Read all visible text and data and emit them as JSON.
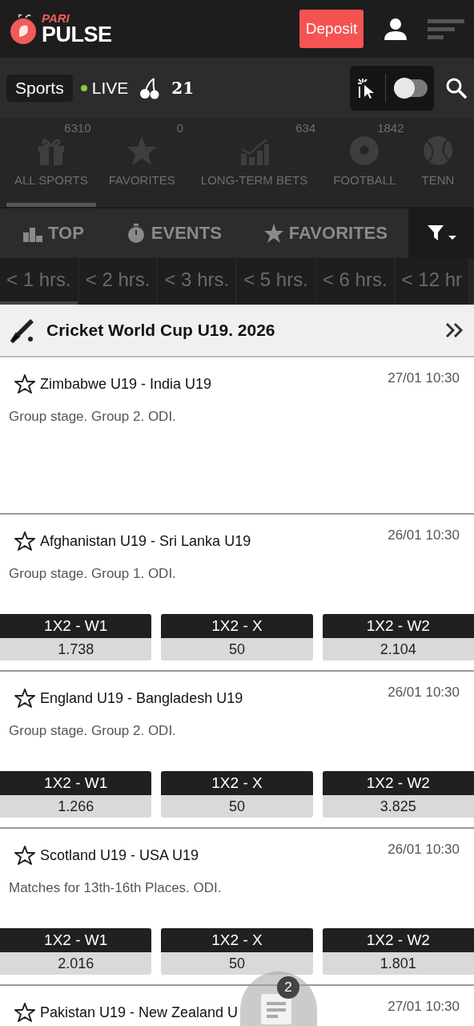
{
  "header": {
    "logo_top": "PARI",
    "logo_bottom": "PULSE",
    "deposit": "Deposit"
  },
  "nav": {
    "sports": "Sports",
    "live": "LIVE",
    "number_icon": "21",
    "toggle_on": false
  },
  "categories": [
    {
      "kind": "gift",
      "count": "6310",
      "label": "ALL SPORTS",
      "selected": true
    },
    {
      "kind": "star",
      "count": "0",
      "label": "FAVORITES",
      "selected": false
    },
    {
      "kind": "chart",
      "count": "634",
      "label": "LONG-TERM BETS",
      "selected": false
    },
    {
      "kind": "ball",
      "count": "1842",
      "label": "FOOTBALL",
      "selected": false
    },
    {
      "kind": "tennis",
      "label": "TENN",
      "selected": false
    }
  ],
  "tabs": [
    {
      "kind": "bars",
      "label": "TOP",
      "selected": false
    },
    {
      "kind": "timer",
      "label": "EVENTS",
      "selected": false
    },
    {
      "kind": "star",
      "label": "FAVORITES",
      "selected": false
    }
  ],
  "time_filters": [
    {
      "label": "< 1 hrs.",
      "selected": true
    },
    {
      "label": "< 2 hrs.",
      "selected": false
    },
    {
      "label": "< 3 hrs.",
      "selected": false
    },
    {
      "label": "< 5 hrs.",
      "selected": false
    },
    {
      "label": "< 6 hrs.",
      "selected": false
    },
    {
      "label": "< 12 hr",
      "selected": false
    }
  ],
  "league": {
    "title": "Cricket World Cup U19. 2026"
  },
  "matches": [
    {
      "teams": "Zimbabwe U19 - India U19",
      "time": "27/01 10:30",
      "info": "Group stage. Group 2. ODI.",
      "favorite": false
    },
    {
      "teams": "Afghanistan U19 - Sri Lanka U19",
      "time": "26/01 10:30",
      "info": "Group stage. Group 1. ODI.",
      "favorite": false,
      "odds": [
        {
          "label": "1X2 - W1",
          "value": "1.738"
        },
        {
          "label": "1X2 - X",
          "value": "50"
        },
        {
          "label": "1X2 - W2",
          "value": "2.104"
        }
      ]
    },
    {
      "teams": "England U19 - Bangladesh U19",
      "time": "26/01 10:30",
      "info": "Group stage. Group 2. ODI.",
      "favorite": false,
      "odds": [
        {
          "label": "1X2 - W1",
          "value": "1.266"
        },
        {
          "label": "1X2 - X",
          "value": "50"
        },
        {
          "label": "1X2 - W2",
          "value": "3.825"
        }
      ]
    },
    {
      "teams": "Scotland U19 - USA U19",
      "time": "26/01 10:30",
      "info": "Matches for 13th-16th Places. ODI.",
      "favorite": false,
      "odds": [
        {
          "label": "1X2 - W1",
          "value": "2.016"
        },
        {
          "label": "1X2 - X",
          "value": "50"
        },
        {
          "label": "1X2 - W2",
          "value": "1.801"
        }
      ]
    },
    {
      "teams": "Pakistan U19 - New Zealand U",
      "time": "27/01 10:30",
      "favorite": false
    }
  ],
  "bet_slip": {
    "count": "2"
  }
}
